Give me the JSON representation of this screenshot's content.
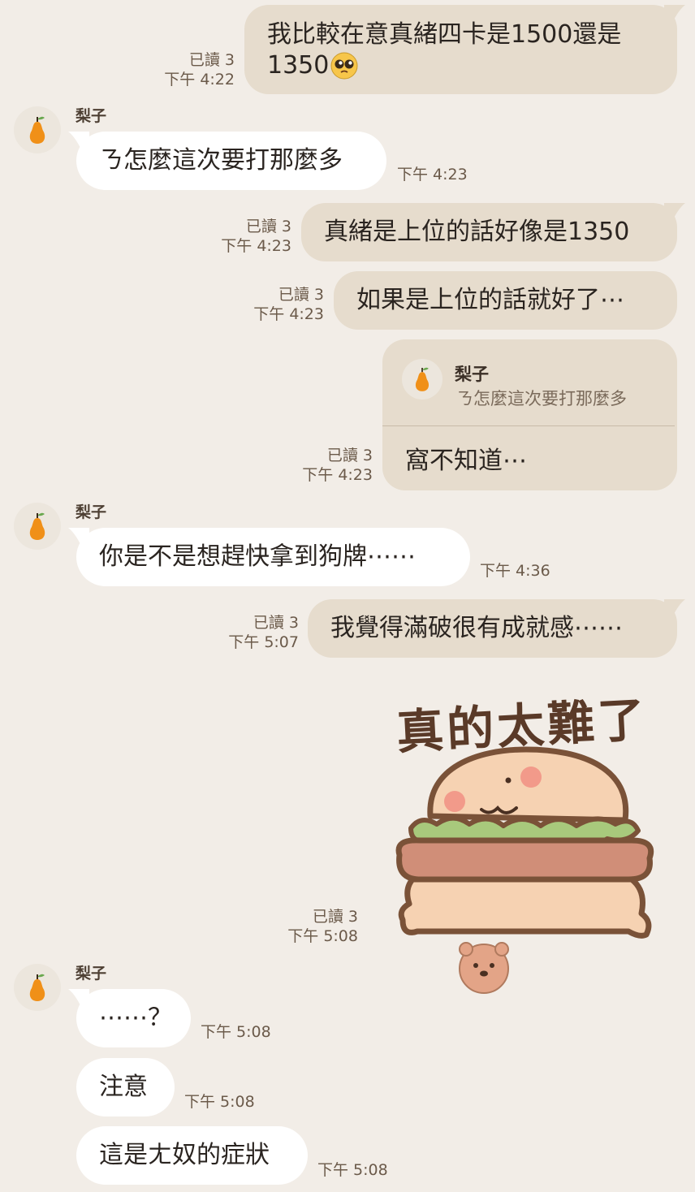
{
  "contact": {
    "name": "梨子",
    "avatar_icon": "pear-icon"
  },
  "colors": {
    "background": "#f2ede7",
    "sent_bubble": "#e6dccd",
    "received_bubble": "#ffffff",
    "meta_text": "#6b5a4a"
  },
  "messages": [
    {
      "direction": "sent",
      "text": "我比較在意真緒四卡是1500還是",
      "text_line2": "1350",
      "emoji": "pleading-face-emoji",
      "read": "已讀 3",
      "time": "下午 4:22"
    },
    {
      "direction": "received",
      "sender": "梨子",
      "text": "ㄋ怎麼這次要打那麼多",
      "time": "下午 4:23"
    },
    {
      "direction": "sent",
      "text": "真緒是上位的話好像是1350",
      "read": "已讀 3",
      "time": "下午 4:23"
    },
    {
      "direction": "sent",
      "text": "如果是上位的話就好了⋯",
      "read": "已讀 3",
      "time": "下午 4:23"
    },
    {
      "direction": "sent",
      "type": "reply",
      "quote_name": "梨子",
      "quote_text": "ㄋ怎麼這次要打那麼多",
      "text": "窩不知道⋯",
      "read": "已讀 3",
      "time": "下午 4:23"
    },
    {
      "direction": "received",
      "sender": "梨子",
      "text": "你是不是想趕快拿到狗牌⋯⋯",
      "time": "下午 4:36"
    },
    {
      "direction": "sent",
      "text": "我覺得滿破很有成就感⋯⋯",
      "read": "已讀 3",
      "time": "下午 5:07"
    },
    {
      "direction": "sent",
      "type": "sticker",
      "sticker_text": "真的太難了",
      "sticker_icon": "burger-character-sticker",
      "read": "已讀 3",
      "time": "下午 5:08"
    },
    {
      "direction": "received",
      "sender": "梨子",
      "text": "⋯⋯？",
      "time": "下午 5:08"
    },
    {
      "direction": "received",
      "text": "注意",
      "time": "下午 5:08"
    },
    {
      "direction": "received",
      "text": "這是ㄤ奴的症狀",
      "time": "下午 5:08"
    }
  ]
}
